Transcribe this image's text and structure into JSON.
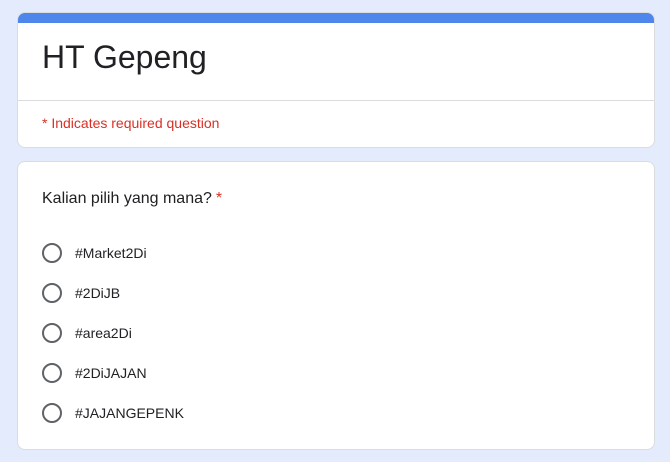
{
  "form": {
    "title": "HT Gepeng",
    "required_note": "* Indicates required question",
    "accent_color": "#4f86ec",
    "required_color": "#d93025"
  },
  "question": {
    "title": "Kalian pilih yang mana?",
    "required_mark": "*",
    "options": [
      {
        "label": "#Market2Di",
        "selected": false
      },
      {
        "label": "#2DiJB",
        "selected": false
      },
      {
        "label": "#area2Di",
        "selected": false
      },
      {
        "label": "#2DiJAJAN",
        "selected": false
      },
      {
        "label": "#JAJANGEPENK",
        "selected": false
      }
    ]
  }
}
